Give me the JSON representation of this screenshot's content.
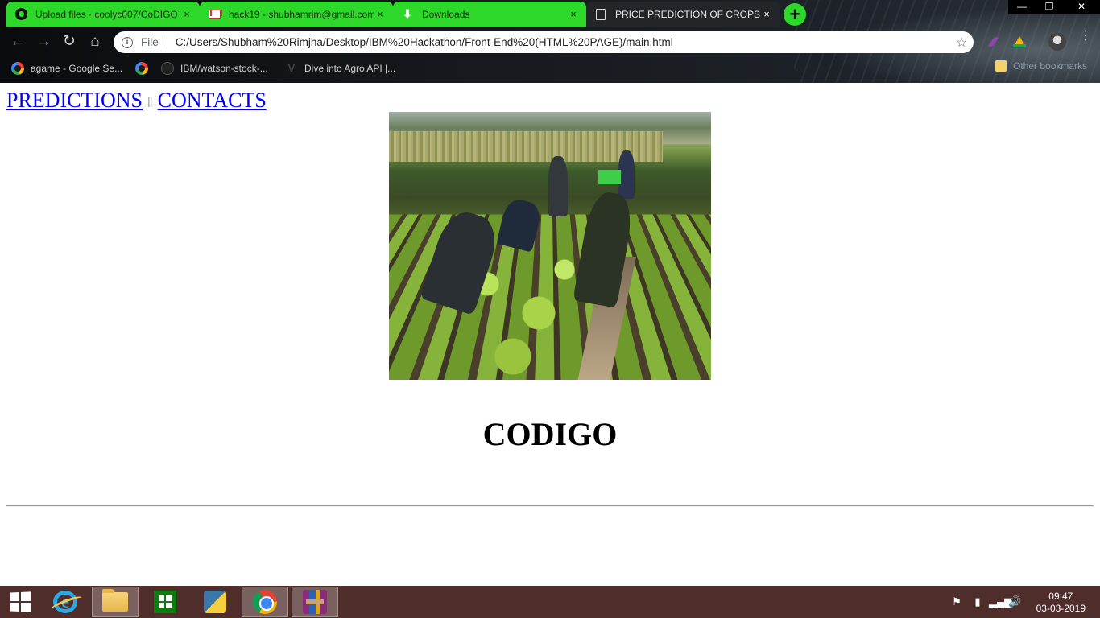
{
  "browser": {
    "tabs": [
      {
        "title": "Upload files · coolyc007/CoDIGO",
        "icon": "github-icon",
        "active": false
      },
      {
        "title": "hack19 - shubhamrim@gmail.com",
        "icon": "gmail-icon",
        "active": false
      },
      {
        "title": "Downloads",
        "icon": "download-icon",
        "active": false
      },
      {
        "title": "PRICE PREDICTION OF CROPS",
        "icon": "document-icon",
        "active": true
      }
    ],
    "tab_close": "×",
    "new_tab": "+",
    "window_controls": {
      "minimize": "—",
      "restore": "❐",
      "close": "✕"
    },
    "nav": {
      "back": "←",
      "forward": "→",
      "reload": "↻",
      "home": "⌂"
    },
    "address": {
      "scheme_label": "File",
      "url": "C:/Users/Shubham%20Rimjha/Desktop/IBM%20Hackathon/Front-End%20(HTML%20PAGE)/main.html",
      "info": "i",
      "star": "☆"
    },
    "bookmarks": [
      {
        "title": "agame - Google Se...",
        "icon": "google-icon"
      },
      {
        "title": "",
        "icon": "google-icon"
      },
      {
        "title": "IBM/watson-stock-...",
        "icon": "github-icon"
      },
      {
        "title": "Dive into Agro API |...",
        "icon": "vue-icon"
      }
    ],
    "other_bookmarks": "Other bookmarks",
    "menu": "⋮"
  },
  "page": {
    "nav_links": [
      "PREDICTIONS",
      "CONTACTS"
    ],
    "nav_separator": "||",
    "hero_alt": "farm workers harvesting crops",
    "heading": "CODIGO"
  },
  "taskbar": {
    "apps": [
      "start-icon",
      "internet-explorer-icon",
      "file-explorer-icon",
      "store-icon",
      "python-icon",
      "chrome-icon",
      "winrar-icon"
    ],
    "tray_icons": [
      "flag-icon",
      "battery-icon",
      "signal-icon",
      "volume-icon"
    ],
    "time": "09:47",
    "date": "03-03-2019"
  },
  "colors": {
    "tab_green": "#2ed82a",
    "link_blue": "#0000ee",
    "taskbar": "#4e2d2a"
  }
}
